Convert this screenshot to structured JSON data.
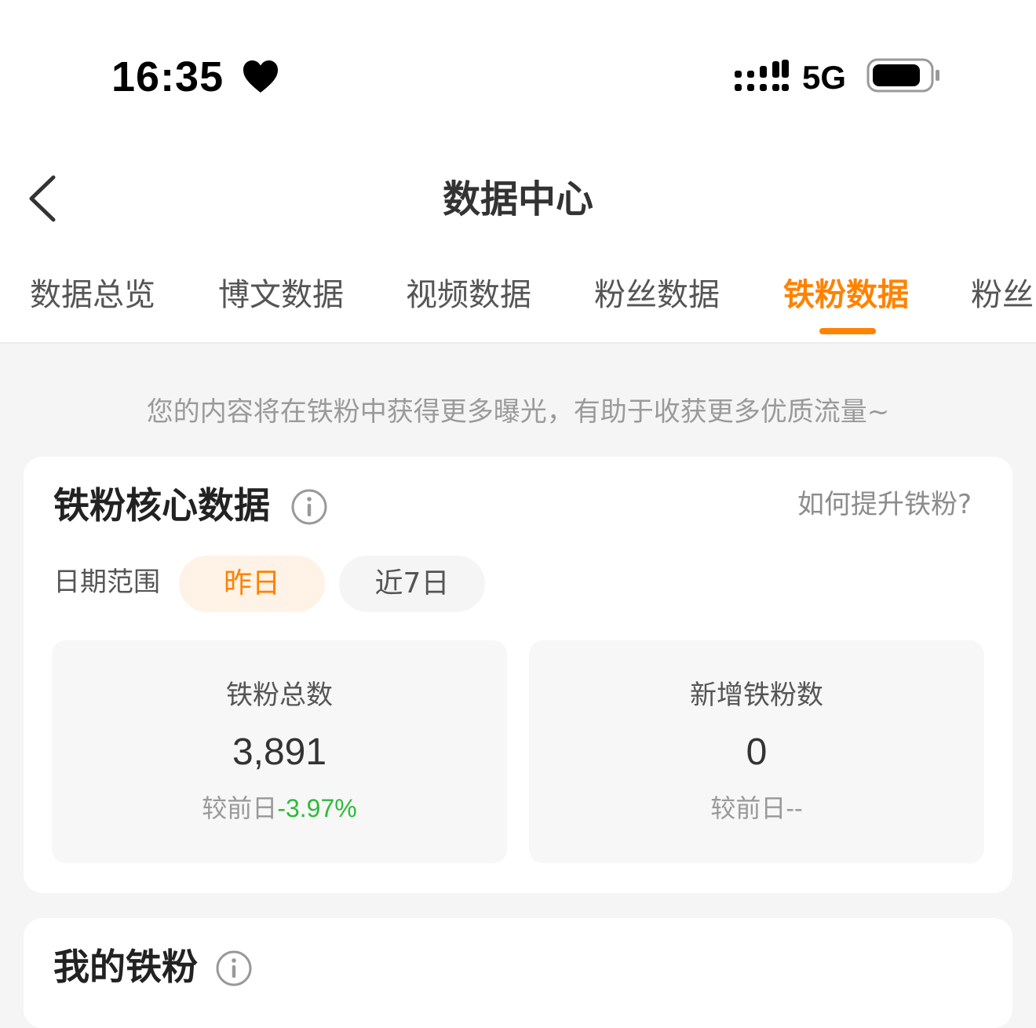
{
  "status_bar": {
    "time": "16:35",
    "network": "5G",
    "icons": [
      "heart-icon",
      "signal-icon",
      "battery-icon"
    ]
  },
  "nav": {
    "back_icon": "chevron-left-icon",
    "title": "数据中心"
  },
  "tabs": [
    {
      "label": "数据总览",
      "active": false
    },
    {
      "label": "博文数据",
      "active": false
    },
    {
      "label": "视频数据",
      "active": false
    },
    {
      "label": "粉丝数据",
      "active": false
    },
    {
      "label": "铁粉数据",
      "active": true
    },
    {
      "label": "粉丝",
      "active": false
    }
  ],
  "notice": "您的内容将在铁粉中获得更多曝光，有助于收获更多优质流量~",
  "core_card": {
    "title": "铁粉核心数据",
    "help_link": "如何提升铁粉?",
    "date_range_label": "日期范围",
    "date_options": [
      {
        "label": "昨日",
        "selected": true
      },
      {
        "label": "近7日",
        "selected": false
      }
    ],
    "stats": [
      {
        "label": "铁粉总数",
        "value": "3,891",
        "compare_label": "较前日",
        "compare_value": "-3.97%"
      },
      {
        "label": "新增铁粉数",
        "value": "0",
        "compare_label": "较前日",
        "compare_value": "--"
      }
    ]
  },
  "my_fans_card": {
    "title": "我的铁粉"
  },
  "colors": {
    "accent": "#ff8200",
    "accent_bg": "#fff2e6",
    "decrease": "#2dbb3a",
    "page_bg": "#f5f5f5"
  }
}
